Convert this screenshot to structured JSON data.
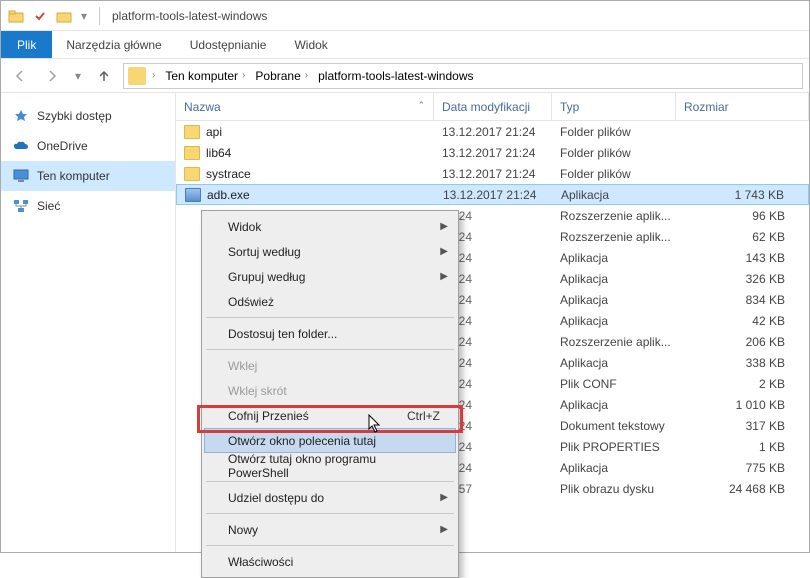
{
  "window": {
    "title": "platform-tools-latest-windows"
  },
  "ribbon": {
    "file": "Plik",
    "tabs": [
      "Narzędzia główne",
      "Udostępnianie",
      "Widok"
    ]
  },
  "breadcrumbs": [
    "Ten komputer",
    "Pobrane",
    "platform-tools-latest-windows"
  ],
  "columns": {
    "name": "Nazwa",
    "date": "Data modyfikacji",
    "type": "Typ",
    "size": "Rozmiar"
  },
  "nav": {
    "quick": "Szybki dostęp",
    "onedrive": "OneDrive",
    "thispc": "Ten komputer",
    "network": "Sieć"
  },
  "rows_visible": [
    {
      "name": "api",
      "date": "13.12.2017 21:24",
      "type": "Folder plików",
      "size": "",
      "icon": "folder"
    },
    {
      "name": "lib64",
      "date": "13.12.2017 21:24",
      "type": "Folder plików",
      "size": "",
      "icon": "folder"
    },
    {
      "name": "systrace",
      "date": "13.12.2017 21:24",
      "type": "Folder plików",
      "size": "",
      "icon": "folder"
    },
    {
      "name": "adb.exe",
      "date": "13.12.2017 21:24",
      "type": "Aplikacja",
      "size": "1 743 KB",
      "icon": "exe",
      "selected": true
    }
  ],
  "rows_under_menu": [
    {
      "date": "21:24",
      "type": "Rozszerzenie aplik...",
      "size": "96 KB"
    },
    {
      "date": "21:24",
      "type": "Rozszerzenie aplik...",
      "size": "62 KB"
    },
    {
      "date": "21:24",
      "type": "Aplikacja",
      "size": "143 KB"
    },
    {
      "date": "21:24",
      "type": "Aplikacja",
      "size": "326 KB"
    },
    {
      "date": "21:24",
      "type": "Aplikacja",
      "size": "834 KB"
    },
    {
      "date": "21:24",
      "type": "Aplikacja",
      "size": "42 KB"
    },
    {
      "date": "21:24",
      "type": "Rozszerzenie aplik...",
      "size": "206 KB"
    },
    {
      "date": "21:24",
      "type": "Aplikacja",
      "size": "338 KB"
    },
    {
      "date": "21:24",
      "type": "Plik CONF",
      "size": "2 KB"
    },
    {
      "date": "21:24",
      "type": "Aplikacja",
      "size": "1 010 KB"
    },
    {
      "date": "21:24",
      "type": "Dokument tekstowy",
      "size": "317 KB"
    },
    {
      "date": "21:24",
      "type": "Plik PROPERTIES",
      "size": "1 KB"
    },
    {
      "date": "21:24",
      "type": "Aplikacja",
      "size": "775 KB"
    },
    {
      "date": "13:57",
      "type": "Plik obrazu dysku",
      "size": "24 468 KB"
    }
  ],
  "context_menu": {
    "items": [
      {
        "label": "Widok",
        "sub": true
      },
      {
        "label": "Sortuj według",
        "sub": true
      },
      {
        "label": "Grupuj według",
        "sub": true
      },
      {
        "label": "Odśwież"
      },
      {
        "sep": true
      },
      {
        "label": "Dostosuj ten folder..."
      },
      {
        "sep": true
      },
      {
        "label": "Wklej",
        "disabled": true
      },
      {
        "label": "Wklej skrót",
        "disabled": true
      },
      {
        "label": "Cofnij Przenieś",
        "shortcut": "Ctrl+Z"
      },
      {
        "label": "Otwórz okno polecenia tutaj",
        "highlight": true
      },
      {
        "label": "Otwórz tutaj okno programu PowerShell"
      },
      {
        "sep": true
      },
      {
        "label": "Udziel dostępu do",
        "sub": true
      },
      {
        "sep": true
      },
      {
        "label": "Nowy",
        "sub": true
      },
      {
        "sep": true
      },
      {
        "label": "Właściwości"
      }
    ]
  }
}
